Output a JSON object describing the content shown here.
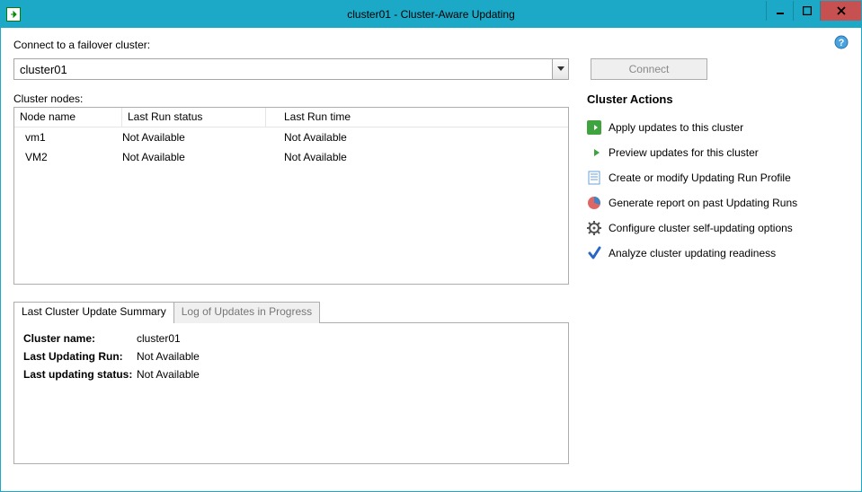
{
  "window": {
    "title": "cluster01 - Cluster-Aware Updating"
  },
  "labels": {
    "connect_to": "Connect to a failover cluster:",
    "connect_btn": "Connect",
    "cluster_nodes": "Cluster nodes:"
  },
  "combo": {
    "value": "cluster01"
  },
  "grid": {
    "columns": [
      "Node name",
      "Last Run status",
      "Last Run time"
    ],
    "rows": [
      {
        "name": "vm1",
        "status": "Not Available",
        "time": "Not Available"
      },
      {
        "name": "VM2",
        "status": "Not Available",
        "time": "Not Available"
      }
    ]
  },
  "tabs": {
    "items": [
      {
        "label": "Last Cluster Update Summary",
        "active": true
      },
      {
        "label": "Log of Updates in Progress",
        "active": false
      }
    ]
  },
  "summary": {
    "rows": [
      {
        "k": "Cluster name:",
        "v": "cluster01"
      },
      {
        "k": "Last Updating Run:",
        "v": "Not Available"
      },
      {
        "k": "Last updating status:",
        "v": "Not Available"
      }
    ]
  },
  "actions": {
    "title": "Cluster Actions",
    "items": [
      {
        "icon": "apply",
        "label": "Apply updates to this cluster"
      },
      {
        "icon": "preview",
        "label": "Preview updates for this cluster"
      },
      {
        "icon": "profile",
        "label": "Create or modify Updating Run Profile"
      },
      {
        "icon": "report",
        "label": "Generate report on past Updating Runs"
      },
      {
        "icon": "gear",
        "label": "Configure cluster self-updating options"
      },
      {
        "icon": "check",
        "label": "Analyze cluster updating readiness"
      }
    ]
  },
  "colors": {
    "titlebar": "#1ca8c7",
    "close": "#c75050"
  }
}
